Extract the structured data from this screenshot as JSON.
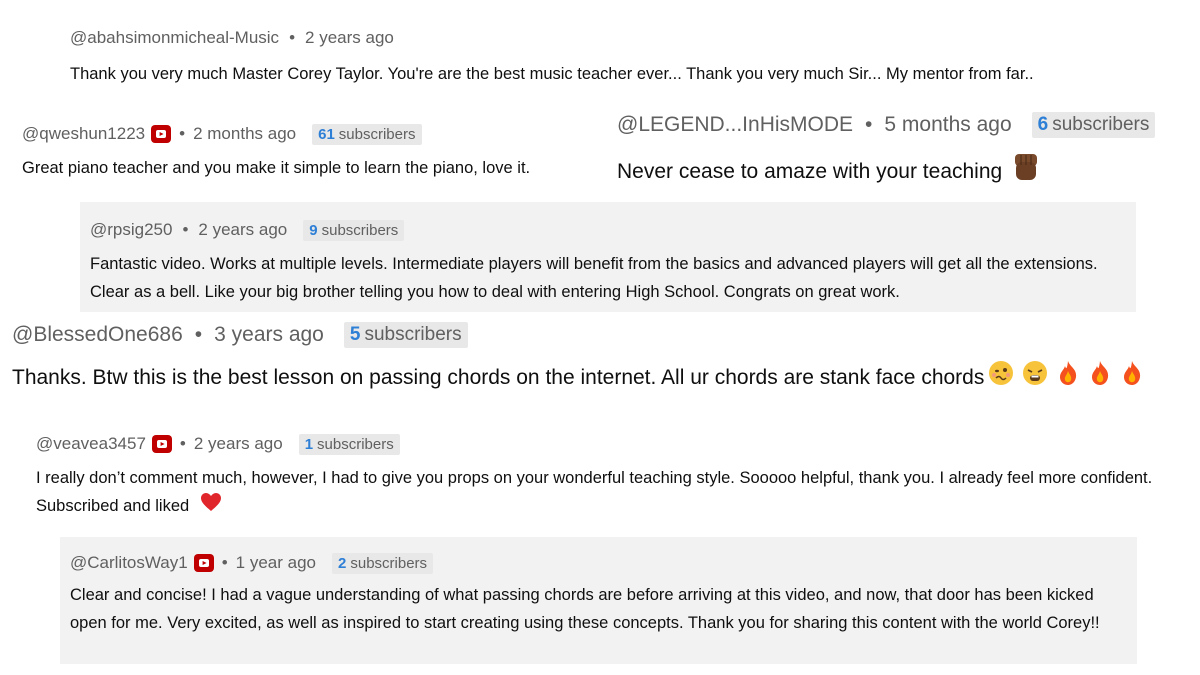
{
  "comments": [
    {
      "handle": "@abahsimonmicheal-Music",
      "time": "2 years ago",
      "text": "Thank you very much Master Corey Taylor. You're are the best music teacher ever... Thank you very much Sir... My mentor from far.."
    },
    {
      "handle": "@qweshun1223",
      "time": "2 months ago",
      "subs_count": "61",
      "subs_label": "subscribers",
      "text": "Great piano teacher and you make it simple to learn the piano, love it."
    },
    {
      "handle": "@LEGEND...InHisMODE",
      "time": "5 months ago",
      "subs_count": "6",
      "subs_label": "subscribers",
      "text": "Never cease to amaze with your teaching",
      "emoji": "raised-fist-medium-dark-skin"
    },
    {
      "handle": "@rpsig250",
      "time": "2 years ago",
      "subs_count": "9",
      "subs_label": "subscribers",
      "text": "Fantastic video.  Works at multiple levels. Intermediate players will benefit from the basics and advanced players will get all the extensions. Clear as a bell. Like your big brother telling you how to deal with entering High School. Congrats on great work."
    },
    {
      "handle": "@BlessedOne686",
      "time": "3 years ago",
      "subs_count": "5",
      "subs_label": "subscribers",
      "text": "Thanks. Btw this is the best lesson on passing chords on the internet. All ur chords are stank face chords",
      "emojis": [
        "woozy-face",
        "weary-face",
        "fire",
        "fire",
        "fire"
      ]
    },
    {
      "handle": "@veavea3457",
      "time": "2 years ago",
      "subs_count": "1",
      "subs_label": "subscribers",
      "text": "I really don’t comment much, however, I had to give you props on your wonderful teaching style. Sooooo helpful, thank you. I already feel more confident. Subscribed and liked",
      "emoji": "red-heart"
    },
    {
      "handle": "@CarlitosWay1",
      "time": "1 year ago",
      "subs_count": "2",
      "subs_label": "subscribers",
      "text": "Clear and concise! I had a vague understanding of what passing chords are before arriving at this video, and now, that door has been kicked open for me. Very excited, as well as inspired to start creating using these concepts. Thank you for sharing this content with the world Corey!!"
    }
  ],
  "separator": "•",
  "colors": {
    "badge_red": "#c00000",
    "subs_number_blue": "#2e7fd6",
    "shaded_bg": "#f2f2f2",
    "meta_gray": "#606060"
  }
}
